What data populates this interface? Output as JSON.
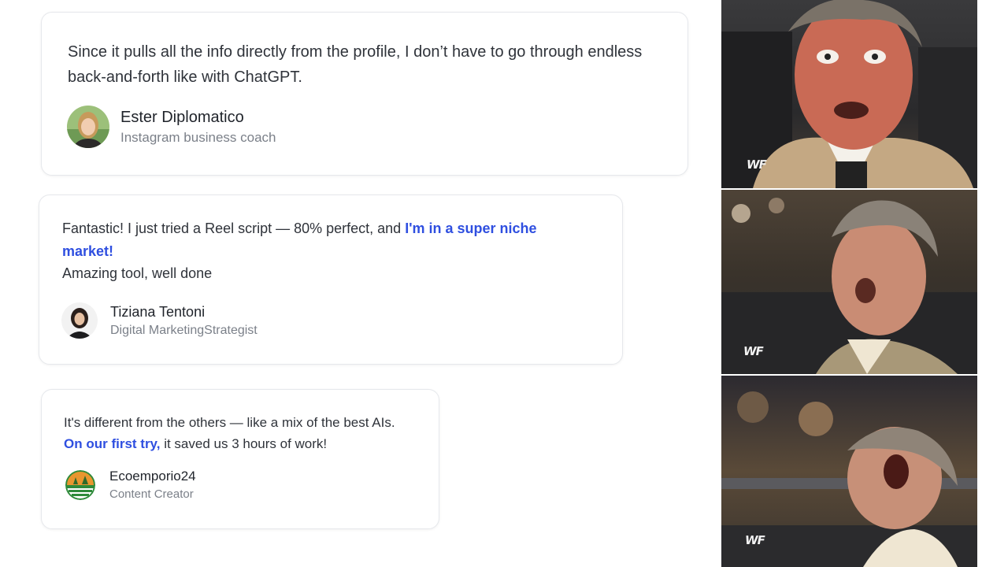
{
  "testimonials": [
    {
      "quote": "Since it pulls all the info directly from the profile, I don’t have to go through endless back-and-forth like with ChatGPT.",
      "name": "Ester Diplomatico",
      "role": "Instagram business coach"
    },
    {
      "quote_part1": "Fantastic! I just tried a Reel script — 80% perfect, and ",
      "quote_highlight": "I'm in a super niche market!",
      "quote_part2": "Amazing tool, well done",
      "name": "Tiziana Tentoni",
      "role": "Digital MarketingStrategist"
    },
    {
      "quote_part1": "It's different from the others — like a mix of the best AIs. ",
      "quote_highlight": "On our first try,",
      "quote_part2": " it saved us 3 hours of work!",
      "name": "Ecoemporio24",
      "role": "Content Creator"
    }
  ],
  "meme": {
    "frames": [
      {
        "logo": "WF"
      },
      {
        "logo": "WF"
      },
      {
        "logo": "WF"
      }
    ]
  },
  "colors": {
    "highlight": "#2f4fe0",
    "text": "#2f333a",
    "muted": "#7b8089"
  }
}
